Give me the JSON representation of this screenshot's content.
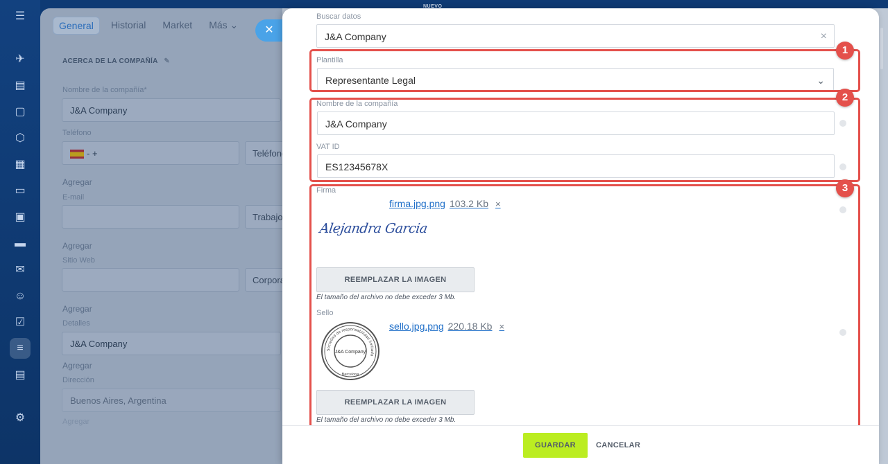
{
  "rail": {
    "icons": [
      "menu-icon",
      "rocket-icon",
      "tasks-icon",
      "chat-icon",
      "hexagon-icon",
      "calendar-icon",
      "document-icon",
      "dashboard-icon",
      "card-icon",
      "mail-icon",
      "contacts-icon",
      "checkbox-icon",
      "filter-icon",
      "id-card-icon",
      "settings-icon"
    ]
  },
  "background": {
    "tabs": [
      "General",
      "Historial",
      "Market",
      "Más ⌄"
    ],
    "badge_nuevo": "NUEVO",
    "section_title": "ACERCA DE LA COMPAÑÍA",
    "company_label": "Nombre de la compañía*",
    "company_value": "J&A Company",
    "phone_label": "Teléfono",
    "phone_prefix": "- +",
    "phone_type": "Teléfono",
    "add_1": "Agregar",
    "email_label": "E-mail",
    "email_type": "Trabajo",
    "add_2": "Agregar",
    "web_label": "Sitio Web",
    "web_type": "Corporativo",
    "add_3": "Agregar",
    "details_label": "Detalles",
    "details_value": "J&A Company",
    "add_4": "Agregar",
    "address_label": "Dirección",
    "address_value": "Buenos Aires, Argentina",
    "address_footer": "Agregar"
  },
  "panel": {
    "search": {
      "label": "Buscar datos",
      "value": "J&A Company",
      "clear": "×"
    },
    "template": {
      "label": "Plantilla",
      "value": "Representante Legal",
      "chevron": "⌄"
    },
    "company": {
      "label": "Nombre de la compañía",
      "value": "J&A Company"
    },
    "vat": {
      "label": "VAT ID",
      "value": "ES12345678X"
    },
    "signature": {
      "label": "Firma",
      "file_name": "firma.jpg.png",
      "file_size": "103.2 Kb",
      "remove": "×",
      "image_text": "Alejandra Garcia",
      "replace_label": "REEMPLAZAR LA IMAGEN",
      "hint": "El tamaño del archivo no debe exceder 3 Mb."
    },
    "stamp": {
      "label": "Sello",
      "file_name": "sello.jpg.png",
      "file_size": "220.18 Kb",
      "remove": "×",
      "seal_center": "J&A Company",
      "seal_ring": "Sociedad de responsabilidad limitada",
      "seal_city": "Barcelona",
      "replace_label": "REEMPLAZAR LA IMAGEN",
      "hint": "El tamaño del archivo no debe exceder 3 Mb."
    },
    "badges": [
      "1",
      "2",
      "3"
    ],
    "highlight_color": "#e4504b"
  },
  "footer": {
    "save_label": "GUARDAR",
    "cancel_label": "CANCELAR",
    "save_color": "#bbed21"
  }
}
